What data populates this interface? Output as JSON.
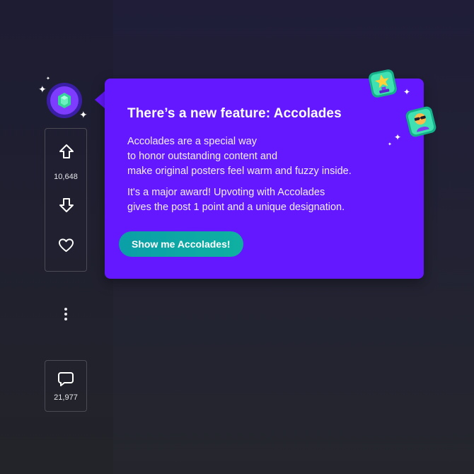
{
  "post": {
    "vote_count": "10,648",
    "comment_count": "21,977"
  },
  "tooltip": {
    "title": "There’s a new feature: Accolades",
    "para1_lines": [
      "Accolades are a special way",
      "to honor outstanding content and",
      "make original posters feel warm and fuzzy inside."
    ],
    "para2_lines": [
      "It's a major award! Upvoting with Accolades",
      "gives the post 1 point and a unique designation."
    ],
    "cta_label": "Show me Accolades!"
  },
  "icons": {
    "badge": "accolade-gem-icon",
    "upvote": "upvote-arrow-icon",
    "downvote": "downvote-arrow-icon",
    "favorite": "heart-icon",
    "more": "vertical-dots-icon",
    "comment": "speech-bubble-icon",
    "award_1": "trophy-award-icon",
    "award_2": "sunglasses-award-icon"
  },
  "colors": {
    "tooltip_bg": "#6418ff",
    "cta_bg": "#0fa8a6",
    "badge_purple": "#7d3cff",
    "gem_green": "#37d39b"
  }
}
